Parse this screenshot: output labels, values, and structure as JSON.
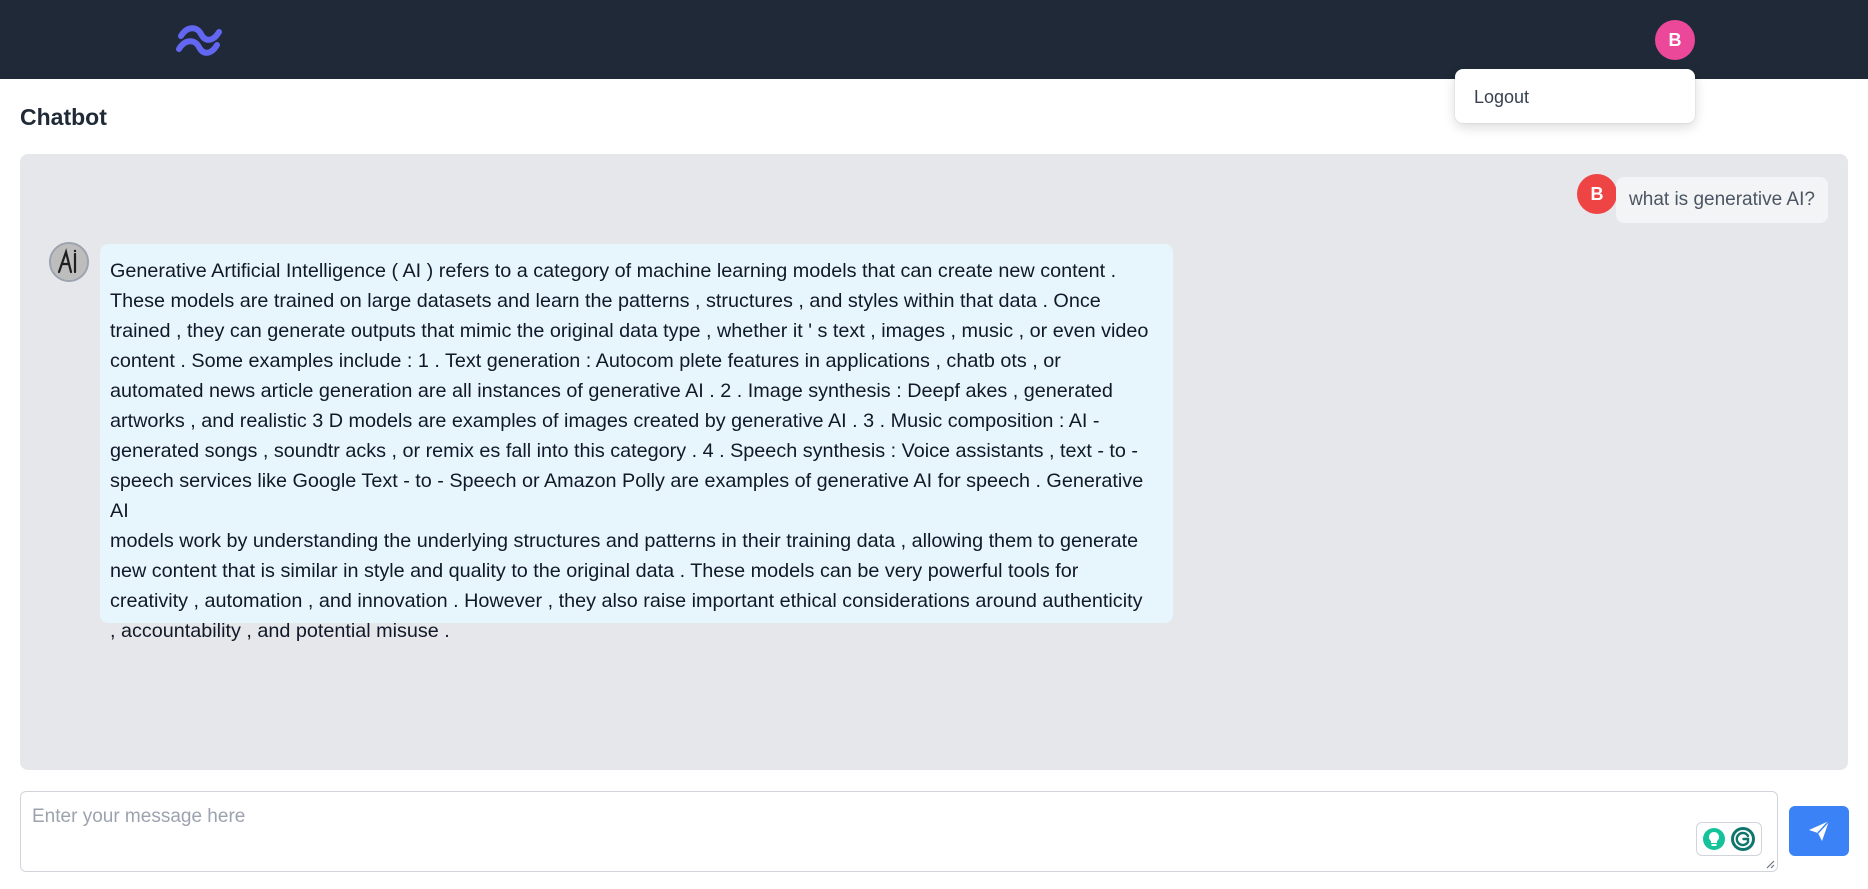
{
  "navbar": {
    "logo_icon": "tailwind-logo-icon",
    "avatar_initial": "B",
    "avatar_color": "#ec4899"
  },
  "dropdown": {
    "items": [
      {
        "label": "Logout"
      }
    ]
  },
  "page": {
    "title": "Chatbot"
  },
  "chat": {
    "messages": [
      {
        "role": "user",
        "avatar_initial": "B",
        "avatar_color": "#ef4444",
        "text": "what is generative AI?"
      },
      {
        "role": "assistant",
        "avatar_icon": "ai-avatar-icon",
        "lines": [
          "Generative Artificial Intelligence ( AI ) refers to a category of machine learning models that can create new content .",
          "These models are trained on large datasets and learn the patterns , structures , and styles within that data . Once",
          "trained , they can generate outputs that mimic the original data type , whether it ' s text , images , music , or even video",
          "content . Some examples include : 1 . Text generation : Autocom plete features in applications , chatb ots , or",
          "automated news article generation are all instances of generative AI . 2 . Image synthesis : Deepf akes , generated",
          "artworks , and realistic 3 D models are examples of images created by generative AI . 3 . Music composition : AI -",
          "generated songs , soundtr acks , or remix es fall into this category . 4 . Speech synthesis : Voice assistants , text - to -",
          "speech services like Google Text - to - Speech or Amazon Polly are examples of generative AI for speech . Generative AI",
          "models work by understanding the underlying structures and patterns in their training data , allowing them to generate",
          "new content that is similar in style and quality to the original data . These models can be very powerful tools for",
          "creativity , automation , and innovation . However , they also raise important ethical considerations around authenticity",
          ", accountability , and potential misuse ."
        ]
      }
    ]
  },
  "composer": {
    "placeholder": "Enter your message here",
    "value": "",
    "send_icon": "paper-plane-icon",
    "accent": "#3b82f6"
  },
  "extension_widget": {
    "icons": [
      "lightbulb-icon",
      "grammarly-icon"
    ]
  }
}
